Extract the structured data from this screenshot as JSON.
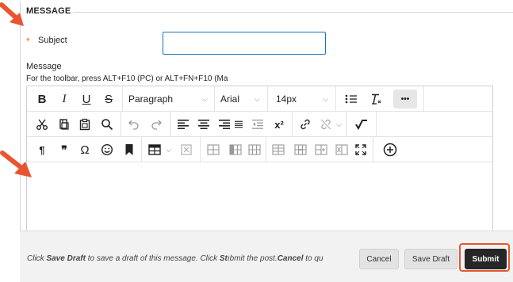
{
  "section": {
    "heading": "MESSAGE"
  },
  "subject": {
    "required_marker": "*",
    "label": "Subject",
    "value": ""
  },
  "message": {
    "label": "Message",
    "toolbar_hint": "For the toolbar, press ALT+F10 (PC) or ALT+FN+F10 (Ma"
  },
  "toolbar": {
    "bold": "B",
    "italic": "I",
    "underline": "U",
    "strikethrough": "S",
    "paragraph_format": "Paragraph",
    "font_family": "Arial",
    "font_size": "14px",
    "more": "•••",
    "superscript": "x²",
    "pilcrow": "¶",
    "blockquote": "❞",
    "omega": "Ω"
  },
  "footer": {
    "hint_part1": "Click ",
    "hint_bold1": "Save Draft",
    "hint_part2": " to save a draft of this message. Click ",
    "hint_bold2": "St",
    "hint_part3": "ıbmit the post.",
    "hint_bold3": "Cancel",
    "hint_part4": " to qu",
    "cancel_label": "Cancel",
    "save_draft_label": "Save Draft",
    "submit_label": "Submit"
  },
  "colors": {
    "accent_orange": "#e8552f",
    "required_star": "#e0701a",
    "input_focus_border": "#1b74b9",
    "submit_bg": "#262626"
  }
}
